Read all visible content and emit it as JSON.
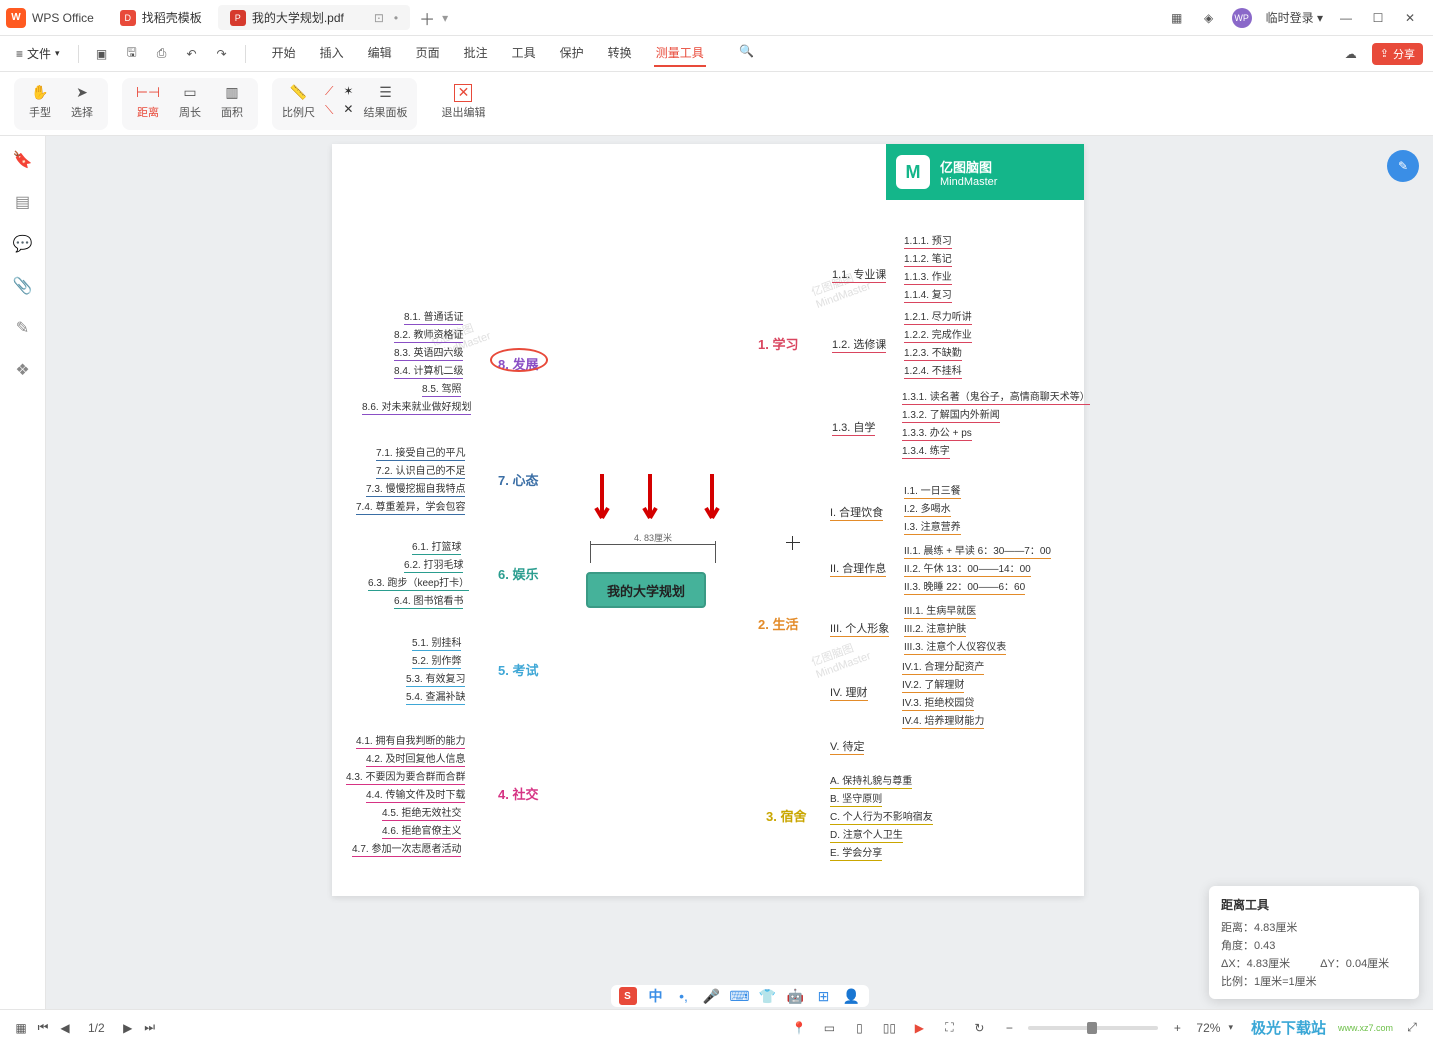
{
  "app": {
    "name": "WPS Office"
  },
  "tabs": [
    {
      "label": "找稻壳模板"
    },
    {
      "label": "我的大学规划.pdf"
    }
  ],
  "login_label": "临时登录",
  "file_btn": "文件",
  "menus": [
    "开始",
    "插入",
    "编辑",
    "页面",
    "批注",
    "工具",
    "保护",
    "转换",
    "测量工具"
  ],
  "active_menu": "测量工具",
  "share_label": "分享",
  "ribbon": {
    "hand": "手型",
    "select": "选择",
    "distance": "距离",
    "perimeter": "周长",
    "area": "面积",
    "ruler": "比例尺",
    "result_panel": "结果面板",
    "exit": "退出编辑"
  },
  "page_info": "1/2",
  "zoom": "72%",
  "badge": {
    "line1": "亿图脑图",
    "line2": "MindMaster"
  },
  "center": "我的大学规划",
  "measure_label": "4. 83厘米",
  "branches_right": {
    "b1": {
      "title": "1. 学习",
      "subs": {
        "s1": {
          "title": "1.1. 专业课",
          "leaves": [
            "1.1.1. 预习",
            "1.1.2. 笔记",
            "1.1.3. 作业",
            "1.1.4. 复习"
          ]
        },
        "s2": {
          "title": "1.2. 选修课",
          "leaves": [
            "1.2.1. 尽力听讲",
            "1.2.2. 完成作业",
            "1.2.3. 不缺勤",
            "1.2.4. 不挂科"
          ]
        },
        "s3": {
          "title": "1.3. 自学",
          "leaves": [
            "1.3.1. 读名著（鬼谷子，高情商聊天术等）",
            "1.3.2. 了解国内外新闻",
            "1.3.3. 办公 + ps",
            "1.3.4. 练字"
          ]
        }
      }
    },
    "b2": {
      "title": "2. 生活",
      "subs": {
        "s1": {
          "title": "I. 合理饮食",
          "leaves": [
            "I.1. 一日三餐",
            "I.2. 多喝水",
            "I.3. 注意营养"
          ]
        },
        "s2": {
          "title": "II. 合理作息",
          "leaves": [
            "II.1. 晨练 + 早读 6：30——7：00",
            "II.2. 午休 13：00——14：00",
            "II.3. 晚睡 22：00——6：60"
          ]
        },
        "s3": {
          "title": "III. 个人形象",
          "leaves": [
            "III.1. 生病早就医",
            "III.2. 注意护肤",
            "III.3. 注意个人仪容仪表"
          ]
        },
        "s4": {
          "title": "IV. 理财",
          "leaves": [
            "IV.1. 合理分配资产",
            "IV.2. 了解理财",
            "IV.3. 拒绝校园贷",
            "IV.4. 培养理财能力"
          ]
        },
        "s5": {
          "title": "V. 待定",
          "leaves": []
        }
      }
    },
    "b3": {
      "title": "3. 宿舍",
      "leaves": [
        "A. 保持礼貌与尊重",
        "B. 坚守原则",
        "C. 个人行为不影响宿友",
        "D. 注意个人卫生",
        "E. 学会分享"
      ]
    }
  },
  "branches_left": {
    "b8": {
      "title": "8. 发展",
      "leaves": [
        "8.1. 普通话证",
        "8.2. 教师资格证",
        "8.3. 英语四六级",
        "8.4. 计算机二级",
        "8.5. 驾照",
        "8.6. 对未来就业做好规划"
      ]
    },
    "b7": {
      "title": "7. 心态",
      "leaves": [
        "7.1. 接受自己的平凡",
        "7.2. 认识自己的不足",
        "7.3. 慢慢挖掘自我特点",
        "7.4. 尊重差异，学会包容"
      ]
    },
    "b6": {
      "title": "6. 娱乐",
      "leaves": [
        "6.1. 打篮球",
        "6.2. 打羽毛球",
        "6.3. 跑步（keep打卡）",
        "6.4. 图书馆看书"
      ]
    },
    "b5": {
      "title": "5. 考试",
      "leaves": [
        "5.1. 别挂科",
        "5.2. 别作弊",
        "5.3. 有效复习",
        "5.4. 查漏补缺"
      ]
    },
    "b4": {
      "title": "4. 社交",
      "leaves": [
        "4.1. 拥有自我判断的能力",
        "4.2. 及时回复他人信息",
        "4.3. 不要因为要合群而合群",
        "4.4. 传输文件及时下载",
        "4.5. 拒绝无效社交",
        "4.6. 拒绝官僚主义",
        "4.7. 参加一次志愿者活动"
      ]
    }
  },
  "tooltip": {
    "title": "距离工具",
    "distance": "距离：4.83厘米",
    "angle": "角度：0.43",
    "dx": "ΔX：4.83厘米",
    "dy": "ΔY：0.04厘米",
    "scale": "比例：1厘米=1厘米"
  },
  "ime": {
    "logo": "S",
    "lang": "中"
  },
  "watermark_site": "www.xz7.com",
  "watermark_name": "极光下载站"
}
